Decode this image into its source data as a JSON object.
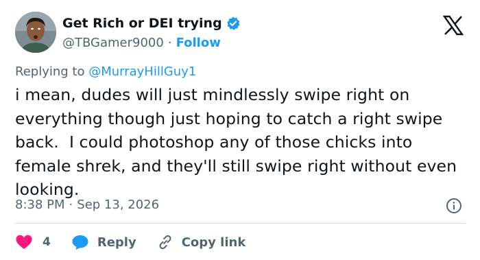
{
  "author": {
    "display_name": "Get Rich or DEI trying",
    "handle": "@TBGamer9000",
    "separator": "·",
    "follow_label": "Follow",
    "verified": true,
    "avatar_icon": "user-avatar"
  },
  "reply": {
    "prefix": "Replying to ",
    "mention": "@MurrayHillGuy1"
  },
  "tweet": {
    "text": "i mean, dudes will just mindlessly swipe right on everything though just hoping to catch a right swipe back.  I could photoshop any of those chicks into female shrek, and they'll still swipe right without even looking."
  },
  "meta": {
    "time": "8:38 PM",
    "separator": "·",
    "date": "Sep 13, 2026"
  },
  "actions": {
    "like_count": "4",
    "reply_label": "Reply",
    "copy_link_label": "Copy link"
  },
  "colors": {
    "accent": "#1d9bf0",
    "like": "#f91880",
    "muted": "#536471",
    "text": "#0f1419",
    "divider": "#cfd9de"
  },
  "icons": [
    "x-logo-icon",
    "verified-badge-icon",
    "info-icon",
    "heart-icon",
    "reply-bubble-icon",
    "link-icon"
  ]
}
